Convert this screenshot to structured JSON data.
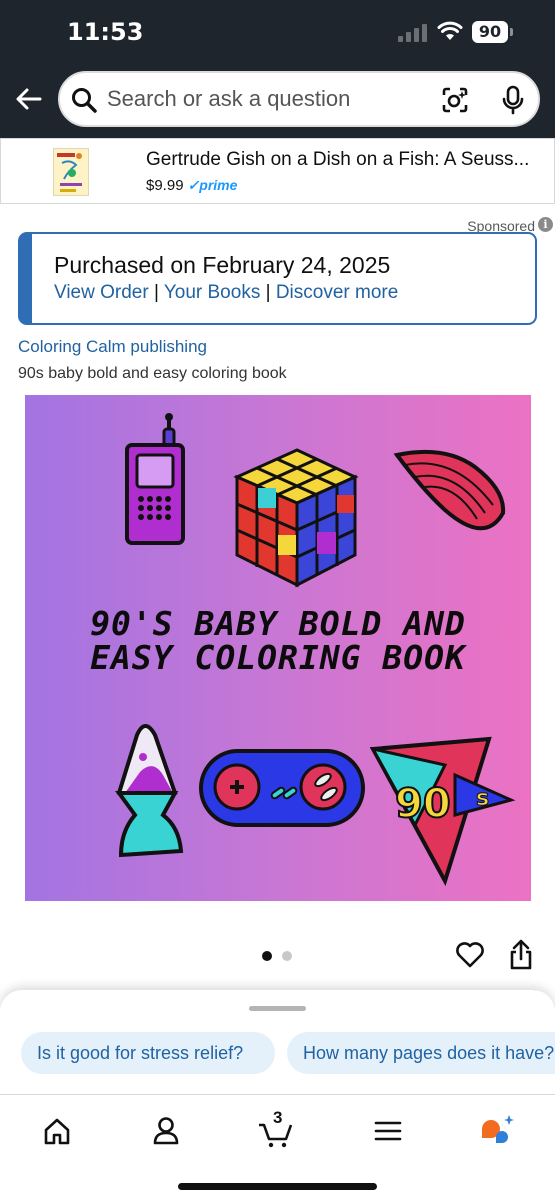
{
  "status": {
    "time": "11:53",
    "battery": "90"
  },
  "search": {
    "placeholder": "Search or ask a question"
  },
  "sponsored_banner": {
    "title": "Gertrude Gish on a Dish on a Fish: A Seuss...",
    "price": "$9.99",
    "prime_label": "prime",
    "sponsored_label": "Sponsored",
    "info_glyph": "i"
  },
  "purchase": {
    "title": "Purchased on February 24, 2025",
    "links": [
      "View Order",
      "Your Books",
      "Discover more"
    ],
    "separator": "|"
  },
  "product": {
    "brand": "Coloring Calm publishing",
    "subtitle": "90s baby bold and easy coloring book",
    "cover_line1": "90'S BABY BOLD AND",
    "cover_line2": "EASY COLORING BOOK",
    "cover_badge": "90",
    "cover_badge_s": "s",
    "image_count": 2,
    "active_image": 1
  },
  "suggestions": [
    "Is it good for stress relief?",
    "How many pages does it have?"
  ],
  "tabbar": {
    "cart_count": "3"
  },
  "colors": {
    "header_bg": "#1f252c",
    "link_blue": "#2162a1",
    "accent_blue": "#2f6eb5",
    "chip_bg": "#e4f1fb",
    "prime_blue": "#1a98ff"
  },
  "icons": [
    "back-arrow-icon",
    "search-icon",
    "camera-icon",
    "mic-icon",
    "heart-icon",
    "share-icon",
    "home-icon",
    "account-icon",
    "cart-icon",
    "menu-icon",
    "rufus-icon"
  ]
}
